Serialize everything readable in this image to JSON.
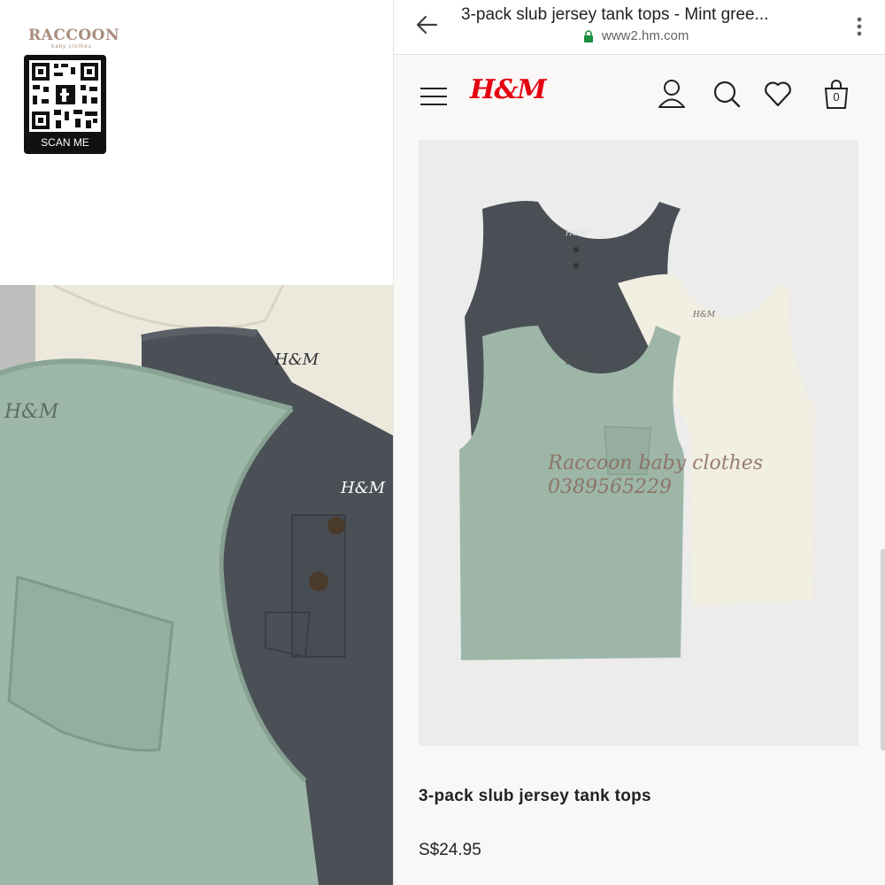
{
  "brand": {
    "name": "RACCOON",
    "tagline": "baby clothes",
    "qr_label": "SCAN ME"
  },
  "browser": {
    "tab_title": "3-pack slub jersey tank tops - Mint gree...",
    "url": "www2.hm.com"
  },
  "site": {
    "logo": "H&M"
  },
  "product": {
    "title": "3-pack slub jersey tank tops",
    "price": "S$24.95",
    "bag_count": "0"
  },
  "watermark": {
    "line1": "Raccoon baby clothes",
    "line2": "0389565229"
  },
  "colors": {
    "mint": "#9cb5a5",
    "charcoal": "#4a4f55",
    "cream": "#efece0",
    "hm_red": "#e50010",
    "accent_brown": "#a98c7d"
  }
}
